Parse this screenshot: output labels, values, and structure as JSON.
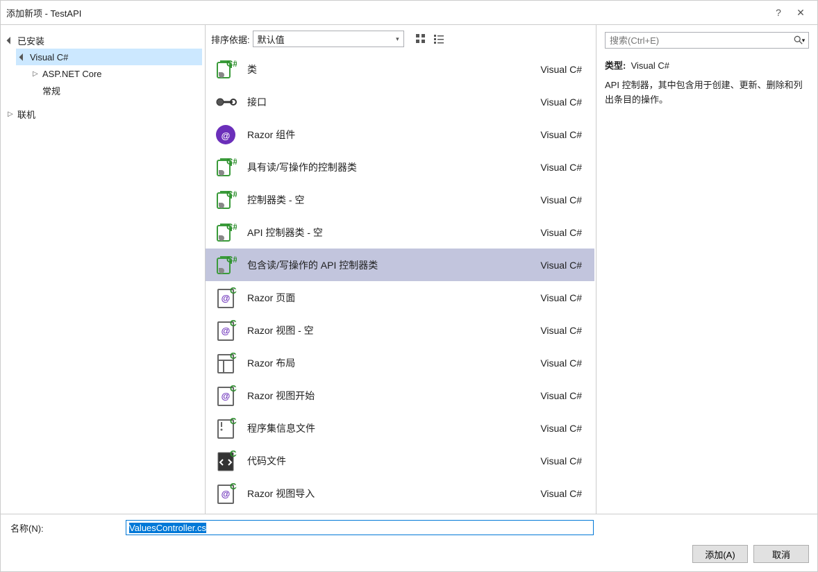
{
  "window": {
    "title": "添加新项 - TestAPI",
    "help": "?",
    "close": "✕"
  },
  "sidebar": {
    "installed": {
      "label": "已安装",
      "expanded": true
    },
    "visual_csharp": {
      "label": "Visual C#",
      "expanded": true,
      "selected": true
    },
    "aspnet_core": {
      "label": "ASP.NET Core",
      "expanded": false
    },
    "general": {
      "label": "常规"
    },
    "online": {
      "label": "联机",
      "expanded": false
    }
  },
  "center": {
    "sort_label": "排序依据:",
    "sort_value": "默认值",
    "items": [
      {
        "icon": "class",
        "label": "类",
        "lang": "Visual C#"
      },
      {
        "icon": "interface",
        "label": "接口",
        "lang": "Visual C#"
      },
      {
        "icon": "razor-component",
        "label": "Razor 组件",
        "lang": "Visual C#"
      },
      {
        "icon": "controller",
        "label": "具有读/写操作的控制器类",
        "lang": "Visual C#"
      },
      {
        "icon": "controller",
        "label": "控制器类 - 空",
        "lang": "Visual C#"
      },
      {
        "icon": "controller",
        "label": "API 控制器类 - 空",
        "lang": "Visual C#"
      },
      {
        "icon": "controller",
        "label": "包含读/写操作的 API 控制器类",
        "lang": "Visual C#",
        "selected": true
      },
      {
        "icon": "razor-page",
        "label": "Razor 页面",
        "lang": "Visual C#"
      },
      {
        "icon": "razor-page",
        "label": "Razor 视图 - 空",
        "lang": "Visual C#"
      },
      {
        "icon": "razor-layout",
        "label": "Razor 布局",
        "lang": "Visual C#"
      },
      {
        "icon": "razor-page",
        "label": "Razor 视图开始",
        "lang": "Visual C#"
      },
      {
        "icon": "assembly-info",
        "label": "程序集信息文件",
        "lang": "Visual C#"
      },
      {
        "icon": "code-file",
        "label": "代码文件",
        "lang": "Visual C#"
      },
      {
        "icon": "razor-page",
        "label": "Razor 视图导入",
        "lang": "Visual C#"
      }
    ]
  },
  "detail": {
    "search_placeholder": "搜索(Ctrl+E)",
    "type_label": "类型:",
    "type_value": "Visual C#",
    "description": "API 控制器，其中包含用于创建、更新、删除和列出条目的操作。"
  },
  "footer": {
    "name_label": "名称(N):",
    "name_value": "ValuesController.cs",
    "add_button": "添加(A)",
    "cancel_button": "取消"
  }
}
